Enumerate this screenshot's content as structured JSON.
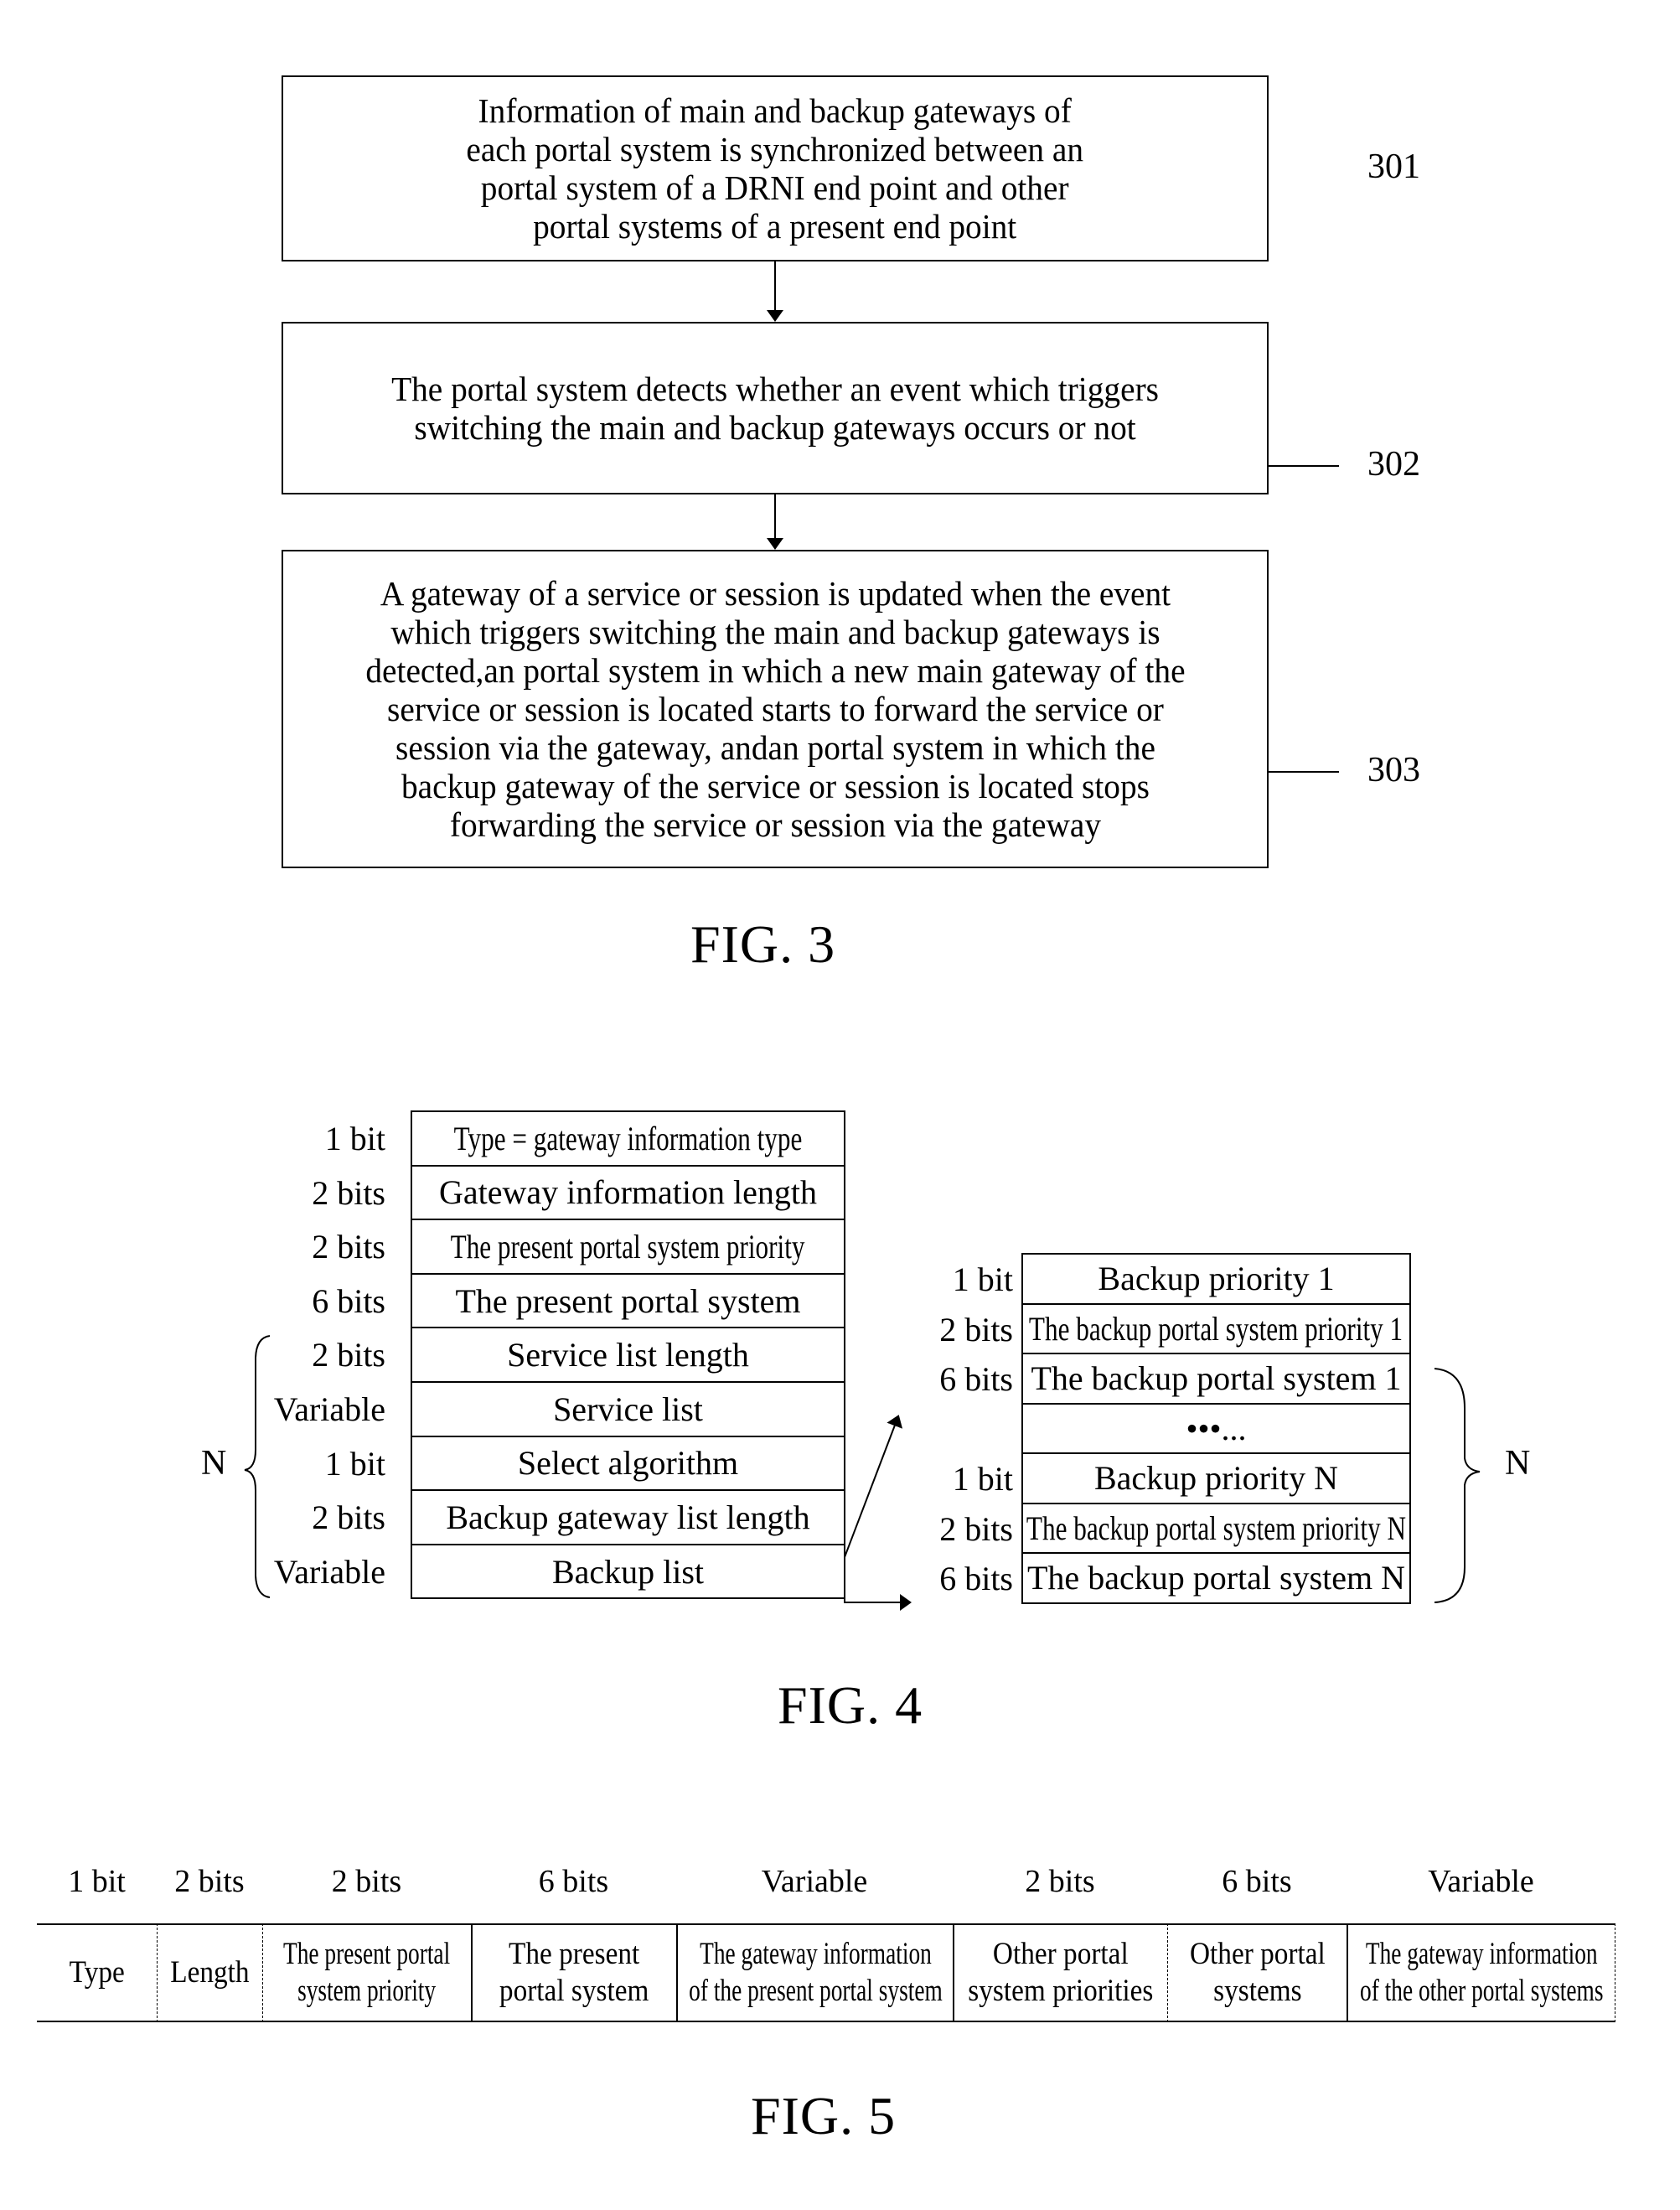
{
  "fig3": {
    "steps": [
      {
        "ref": "301",
        "text": "Information of main and backup gateways of\neach portal system is synchronized between an\nportal system of a DRNI end point and other\nportal systems of a present end point"
      },
      {
        "ref": "302",
        "text": "The portal system detects whether an event which triggers\nswitching the main and backup gateways occurs or not"
      },
      {
        "ref": "303",
        "text": "A gateway of a service or session is updated when the event\nwhich triggers switching the main and backup gateways is\ndetected,an portal system in which a new main gateway of the\nservice or session is located starts to forward the service or\nsession via the gateway, andan portal system in which the\nbackup gateway of the service or session is located stops\nforwarding the service or session via the gateway"
      }
    ],
    "caption": "FIG. 3"
  },
  "fig4": {
    "left_table": [
      {
        "size": "1 bit",
        "field": "Type = gateway information type"
      },
      {
        "size": "2 bits",
        "field": "Gateway information length"
      },
      {
        "size": "2 bits",
        "field": "The present portal system priority"
      },
      {
        "size": "6 bits",
        "field": "The present portal system"
      },
      {
        "size": "2 bits",
        "field": "Service list length"
      },
      {
        "size": "Variable",
        "field": "Service list"
      },
      {
        "size": "1 bit",
        "field": "Select algorithm"
      },
      {
        "size": "2 bits",
        "field": "Backup gateway list length"
      },
      {
        "size": "Variable",
        "field": "Backup list"
      }
    ],
    "left_brace_label": "N",
    "right_table": [
      {
        "size": "1 bit",
        "field": "Backup priority 1"
      },
      {
        "size": "2 bits",
        "field": "The backup portal system priority 1"
      },
      {
        "size": "6 bits",
        "field": "The backup portal system 1"
      },
      {
        "size": "",
        "field": "•••..."
      },
      {
        "size": "1 bit",
        "field": "Backup priority N"
      },
      {
        "size": "2 bits",
        "field": "The backup portal system priority N"
      },
      {
        "size": "6 bits",
        "field": "The backup portal system N"
      }
    ],
    "right_brace_label": "N",
    "caption": "FIG. 4"
  },
  "fig5": {
    "fields": [
      {
        "size": "1 bit",
        "field": "Type"
      },
      {
        "size": "2 bits",
        "field": "Length"
      },
      {
        "size": "2 bits",
        "field": "The present portal\nsystem priority"
      },
      {
        "size": "6 bits",
        "field": "The present\nportal system"
      },
      {
        "size": "Variable",
        "field": "The gateway information\nof the present portal system"
      },
      {
        "size": "2 bits",
        "field": "Other portal\nsystem priorities"
      },
      {
        "size": "6 bits",
        "field": "Other portal\nsystems"
      },
      {
        "size": "Variable",
        "field": "The gateway information\nof the other portal systems"
      }
    ],
    "caption": "FIG. 5"
  }
}
